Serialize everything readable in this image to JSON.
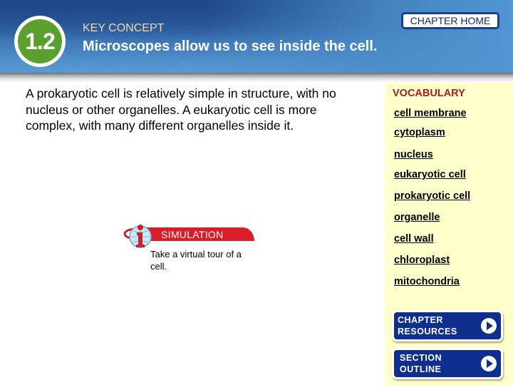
{
  "header": {
    "section_number": "1.2",
    "key_concept_label": "KEY CONCEPT",
    "title": "Microscopes allow us to see inside the cell.",
    "chapter_home_label": "CHAPTER HOME"
  },
  "main": {
    "body_text": "A prokaryotic cell is relatively simple in structure, with no nucleus or other organelles.  A eukaryotic cell is more complex, with many different organelles inside it."
  },
  "simulation": {
    "icon": "info-globe-icon",
    "label": "SIMULATION",
    "description": "Take a virtual tour of a cell."
  },
  "sidebar": {
    "vocab_title": "VOCABULARY",
    "vocab_items": [
      "cell membrane",
      "cytoplasm",
      "nucleus",
      "eukaryotic cell",
      "prokaryotic cell",
      "organelle",
      "cell wall",
      "chloroplast",
      "mitochondria"
    ],
    "buttons": [
      {
        "label_line1": "CHAPTER",
        "label_line2": "RESOURCES",
        "icon": "play-icon"
      },
      {
        "label_line1": "SECTION",
        "label_line2": "OUTLINE",
        "icon": "play-icon"
      }
    ]
  },
  "colors": {
    "header_blue": "#2d63a6",
    "badge_green": "#5aa02c",
    "vocab_red": "#b01c1c",
    "sidebar_bg": "#ffffcc",
    "button_blue": "#0f2f8f",
    "simulation_red": "#d91e2a"
  }
}
